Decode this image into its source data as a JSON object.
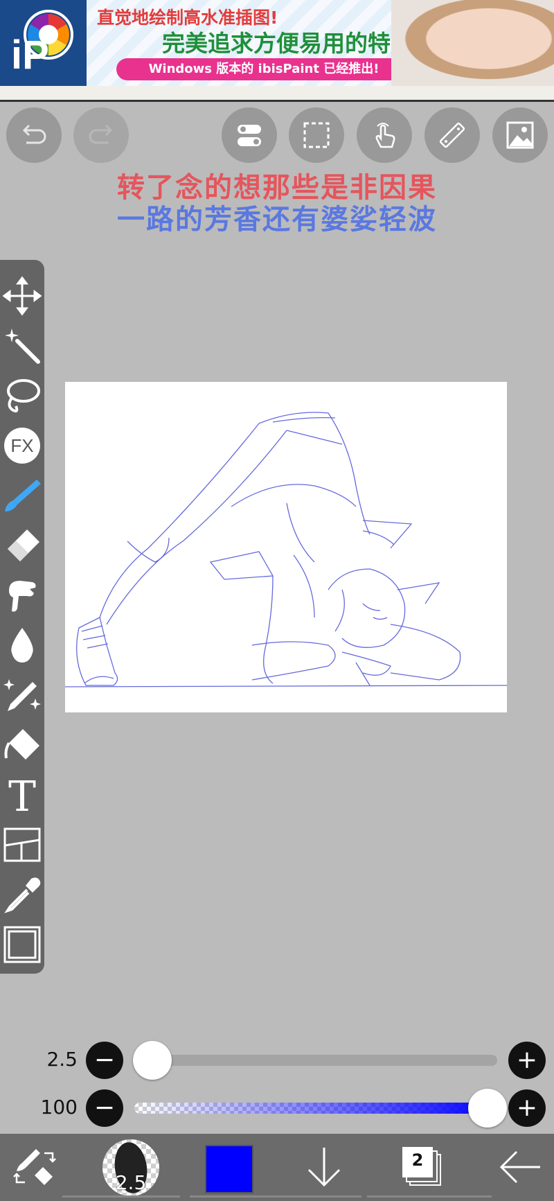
{
  "ad": {
    "line1": "直觉地绘制高水准插图!",
    "line2": "完美追求方便易用的特点!",
    "pill": "Windows 版本的 ibisPaint 已经推出!",
    "logo_text": "iP"
  },
  "lyrics": {
    "line1": "转了念的想那些是非因果",
    "line2": "一路的芳香还有婆娑轻波"
  },
  "toolbar": {
    "undo_icon": "undo-arrow-icon",
    "redo_icon": "redo-arrow-icon",
    "items": [
      "toggle-icon",
      "selection-icon",
      "touch-gesture-icon",
      "ruler-icon",
      "image-icon"
    ]
  },
  "left_tools": [
    "move-transform",
    "magic-wand",
    "lasso",
    "filter",
    "brush",
    "eraser",
    "smudge",
    "blur",
    "special-pen",
    "fill",
    "text",
    "frame-divider",
    "eyedropper",
    "canvas"
  ],
  "fx_label": "FX",
  "text_tool_label": "T",
  "brush_size": {
    "label": "2.5",
    "value": 2.5,
    "fraction": 0.02
  },
  "opacity": {
    "label": "100",
    "value": 100,
    "fraction": 1.0
  },
  "minus_symbol": "−",
  "plus_symbol": "+",
  "bottom": {
    "brush_preview_size": "2.5",
    "color": "#0000ff",
    "layer_count": "2"
  }
}
